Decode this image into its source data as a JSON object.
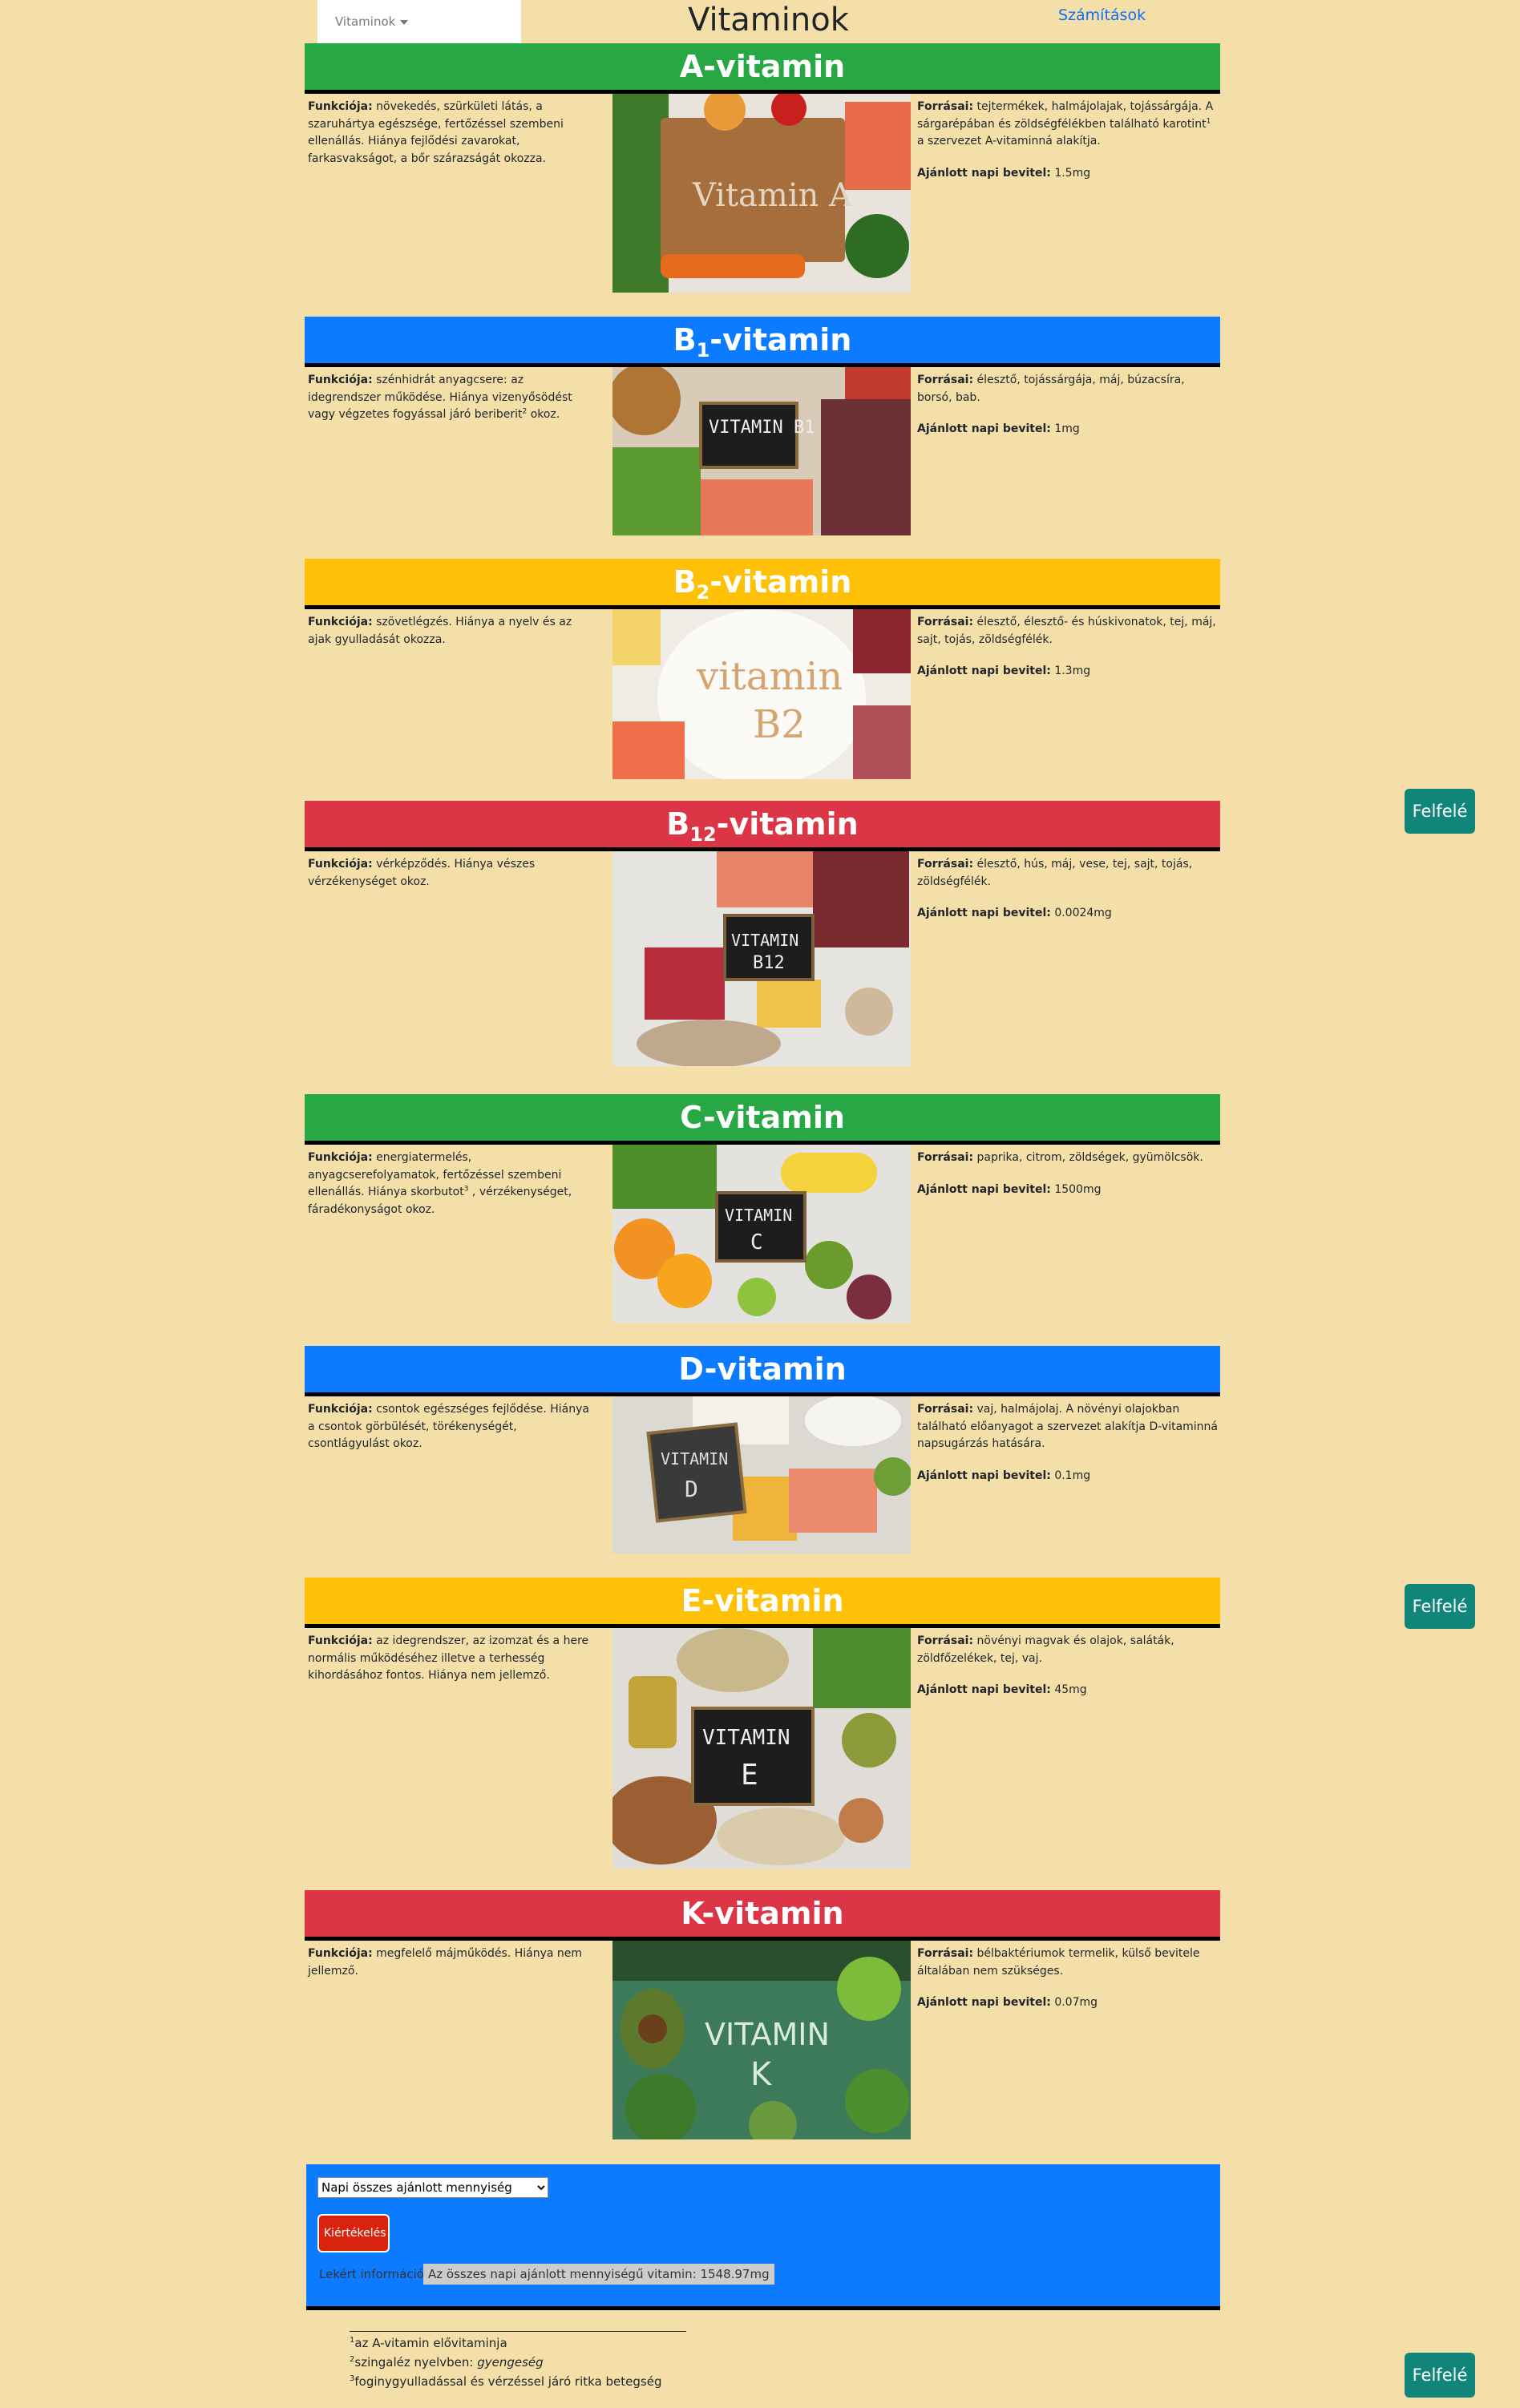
{
  "nav": {
    "dropdown_label": "Vitaminok",
    "title": "Vitaminok",
    "link": "Számítások"
  },
  "labels": {
    "function": "Funkciója:",
    "sources": "Forrásai:",
    "daily": "Ajánlott napi bevitel:"
  },
  "vitamins": [
    {
      "name_main": "A-vitamin",
      "name_pre": "",
      "name_sub": "",
      "name_post": "",
      "function": "növekedés, szürkületi látás, a szaruhártya egészsége, fertőzéssel szembeni ellenállás. Hiánya fejlődési zavarokat, farkasvakságot, a bőr szárazságát okozza.",
      "sources_a": "tejtermékek, halmájolajak, tojássárgája. A sárgarépában és zöldségfélékben található karotint",
      "sources_sup": "1",
      "sources_b": " a szervezet A-vitaminná alakítja.",
      "daily": "1.5mg",
      "image_text": "Vitamin A"
    },
    {
      "name_main": "",
      "name_pre": "B",
      "name_sub": "1",
      "name_post": "-vitamin",
      "function_a": "szénhidrát anyagcsere: az idegrendszer működése. Hiánya vizenyősödést vagy végzetes fogyással járó beriberit",
      "function_sup": "2",
      "function_b": " okoz.",
      "sources": "élesztő, tojássárgája, máj, búzacsíra, borsó, bab.",
      "daily": "1mg",
      "image_text": "VITAMIN B1"
    },
    {
      "name_main": "",
      "name_pre": "B",
      "name_sub": "2",
      "name_post": "-vitamin",
      "function": "szövetlégzés. Hiánya a nyelv és az ajak gyulladását okozza.",
      "sources": "élesztő, élesztő- és húskivonatok, tej, máj, sajt, tojás, zöldségfélék.",
      "daily": "1.3mg",
      "image_text": "vitamin B2"
    },
    {
      "name_main": "",
      "name_pre": "B",
      "name_sub": "12",
      "name_post": "-vitamin",
      "function": "vérképződés. Hiánya vészes vérzékenységet okoz.",
      "sources": "élesztő, hús, máj, vese, tej, sajt, tojás, zöldségfélék.",
      "daily": "0.0024mg",
      "image_text": "VITAMIN B12"
    },
    {
      "name_main": "C-vitamin",
      "function_a": "energiatermelés, anyagcserefolyamatok, fertőzéssel szembeni ellenállás. Hiánya skorbutot",
      "function_sup": "3",
      "function_b": " , vérzékenységet, fáradékonyságot okoz.",
      "sources": "paprika, citrom, zöldségek, gyümölcsök.",
      "daily": "1500mg",
      "image_text": "VITAMIN C"
    },
    {
      "name_main": "D-vitamin",
      "function": "csontok egészséges fejlődése. Hiánya a csontok görbülését, törékenységét, csontlágyulást okoz.",
      "sources": "vaj, halmájolaj. A növényi olajokban található előanyagot a szervezet alakítja D-vitaminná napsugárzás hatására.",
      "daily": "0.1mg",
      "image_text": "VITAMIN D"
    },
    {
      "name_main": "E-vitamin",
      "function": "az idegrendszer, az izomzat és a here normális működéséhez illetve a terhesség kihordásához fontos. Hiánya nem jellemző.",
      "sources": "növényi magvak és olajok, saláták, zöldfőzelékek, tej, vaj.",
      "daily": "45mg",
      "image_text": "VITAMIN E"
    },
    {
      "name_main": "K-vitamin",
      "function": "megfelelő májműködés. Hiánya nem jellemző.",
      "sources": "bélbaktériumok termelik, külső bevitele általában nem szükséges.",
      "daily": "0.07mg",
      "image_text": "VITAMIN K"
    }
  ],
  "up_button": "Felfelé",
  "calc": {
    "select_value": "Napi összes ajánlott mennyiség",
    "button": "Kiértékelés",
    "result_label": "Lekért információ:",
    "result_value": "Az összes napi ajánlott mennyiségű vitamin: 1548.97mg"
  },
  "footnotes": [
    {
      "num": "1",
      "text": "az A-vitamin elővitaminja",
      "italic": ""
    },
    {
      "num": "2",
      "text": "szingaléz nyelvben: ",
      "italic": "gyengeség"
    },
    {
      "num": "3",
      "text": "foginygyulladással és vérzéssel járó ritka betegség",
      "italic": ""
    }
  ],
  "colors": {
    "background": "#f5dfa9",
    "green": "#28a745",
    "blue": "#0d7bff",
    "yellow": "#ffc107",
    "red": "#dc3545",
    "teal_button": "#12857a",
    "eval_button": "#d9230f"
  }
}
